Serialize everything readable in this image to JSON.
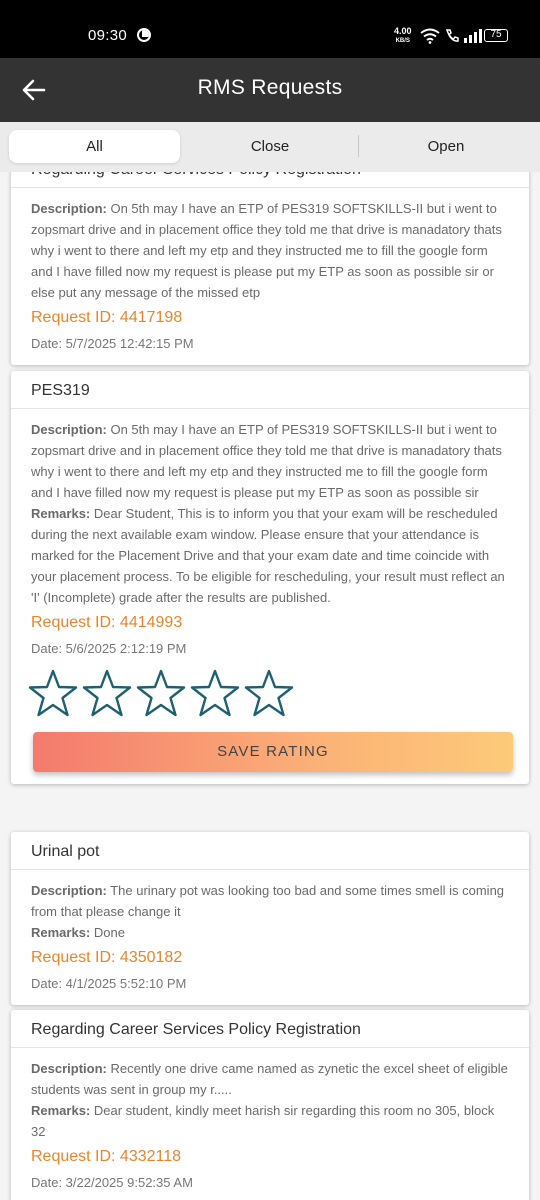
{
  "status_bar": {
    "time": "09:30",
    "speed_value": "4.00",
    "speed_unit": "KB/S",
    "battery": "75"
  },
  "app_bar": {
    "title": "RMS Requests",
    "back_icon": "arrow-left-icon"
  },
  "tabs": [
    {
      "label": "All",
      "active": true
    },
    {
      "label": "Close",
      "active": false
    },
    {
      "label": "Open",
      "active": false
    }
  ],
  "requests": [
    {
      "title": "Regarding Career Services Policy Registration",
      "description_label": "Description:",
      "description": "On 5th may I have an ETP of PES319 SOFTSKILLS-II but i went to zopsmart drive and in placement office they told me that drive is manadatory thats why i went to there and left my etp and they instructed me to fill the google form and I have filled now my request is please put my ETP as soon as possible sir or else put any message of the missed etp",
      "request_id": "Request ID: 4417198",
      "date": "Date: 5/7/2025 12:42:15 PM"
    },
    {
      "title": "PES319",
      "description_label": "Description:",
      "description": "On 5th may I have an ETP of PES319 SOFTSKILLS-II but i went to zopsmart drive and in placement office they told me that drive is manadatory thats why i went to there and left my etp and they instructed me to fill the google form and I have filled now my request is please put my ETP as soon as possible sir",
      "remarks_label": "Remarks:",
      "remarks": "Dear Student, This is to inform you that your exam will be rescheduled during the next available exam window. Please ensure that your attendance is marked for the Placement Drive and that your exam date and time coincide with your placement process. To be eligible for rescheduling, your result must reflect an 'I' (Incomplete) grade after the results are published.",
      "request_id": "Request ID: 4414993",
      "date": "Date: 5/6/2025 2:12:19 PM",
      "rating": {
        "stars_total": 5,
        "stars_filled": 0,
        "save_label": "SAVE RATING"
      }
    },
    {
      "title": "Urinal pot",
      "description_label": "Description:",
      "description": "The urinary pot was looking too bad and some times smell is coming from that please change it",
      "remarks_label": "Remarks:",
      "remarks": "Done",
      "request_id": "Request ID: 4350182",
      "date": "Date: 4/1/2025 5:52:10 PM"
    },
    {
      "title": "Regarding Career Services Policy Registration",
      "description_label": "Description:",
      "description": "Recently one drive came named as zynetic the excel sheet of eligible students was sent in group my r.....",
      "remarks_label": "Remarks:",
      "remarks": "Dear student, kindly meet harish sir regarding this room no 305, block 32",
      "request_id": "Request ID: 4332118",
      "date": "Date: 3/22/2025 9:52:35 AM"
    }
  ],
  "colors": {
    "app_bar": "#333333",
    "accent_orange": "#e8852c",
    "star_outline": "#1f6070"
  }
}
